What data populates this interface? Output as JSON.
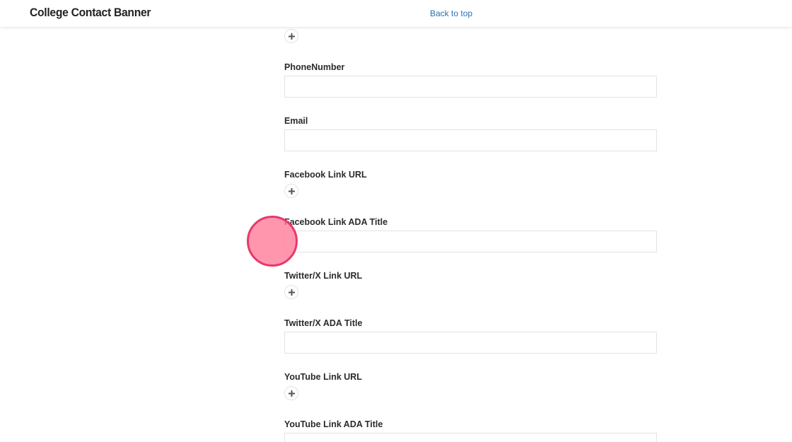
{
  "header": {
    "title": "College Contact Banner",
    "back_to_top": "Back to top"
  },
  "form": {
    "fields": [
      {
        "label": "PhoneNumber",
        "type": "text",
        "value": ""
      },
      {
        "label": "Email",
        "type": "text",
        "value": ""
      },
      {
        "label": "Facebook Link URL",
        "type": "link"
      },
      {
        "label": "Facebook Link ADA Title",
        "type": "text",
        "value": ""
      },
      {
        "label": "Twitter/X Link URL",
        "type": "link"
      },
      {
        "label": "Twitter/X ADA Title",
        "type": "text",
        "value": ""
      },
      {
        "label": "YouTube Link URL",
        "type": "link"
      },
      {
        "label": "YouTube Link ADA Title",
        "type": "text",
        "value": ""
      }
    ],
    "add_icon": "plus-icon"
  },
  "colors": {
    "link": "#2a6fb0",
    "cursor_fill": "#ff7896",
    "cursor_border": "#e8386a",
    "input_border": "#e3e3e3"
  }
}
